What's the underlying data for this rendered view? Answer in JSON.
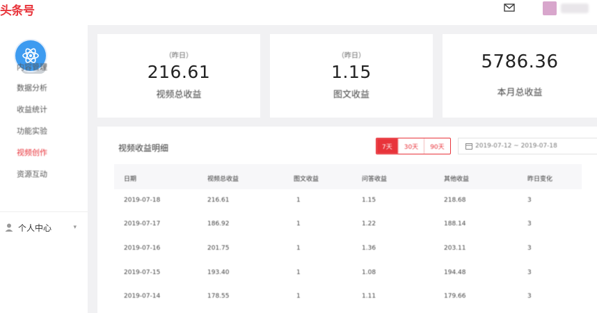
{
  "topbar": {
    "logo": "头条号"
  },
  "sidebar": {
    "items": [
      {
        "label": "内容管理"
      },
      {
        "label": "数据分析"
      },
      {
        "label": "收益统计"
      },
      {
        "label": "功能实验"
      },
      {
        "label": "视频创作"
      },
      {
        "label": "资源互动"
      }
    ],
    "personal": "个人中心"
  },
  "stats": [
    {
      "sub": "（昨日）",
      "value": "216.61",
      "label": "视频总收益"
    },
    {
      "sub": "（昨日）",
      "value": "1.15",
      "label": "图文收益"
    },
    {
      "sub": "",
      "value": "5786.36",
      "label": "本月总收益"
    }
  ],
  "panel": {
    "title": "视频收益明细",
    "ranges": [
      "7天",
      "30天",
      "90天"
    ],
    "date_range": "2019-07-12 ~ 2019-07-18",
    "columns": [
      "日期",
      "视频总收益",
      "图文收益",
      "问答收益",
      "其他收益",
      "昨日变化"
    ],
    "rows": [
      [
        "2019-07-18",
        "216.61",
        "1",
        "1.15",
        "218.68",
        "3"
      ],
      [
        "2019-07-17",
        "186.92",
        "1",
        "1.22",
        "188.14",
        "3"
      ],
      [
        "2019-07-16",
        "201.75",
        "1",
        "1.36",
        "203.11",
        "3"
      ],
      [
        "2019-07-15",
        "193.40",
        "1",
        "1.08",
        "194.48",
        "3"
      ],
      [
        "2019-07-14",
        "178.55",
        "1",
        "1.11",
        "179.66",
        "3"
      ]
    ]
  },
  "colors": {
    "brand": "#e8333a",
    "app_icon": "#3d9bf0"
  }
}
